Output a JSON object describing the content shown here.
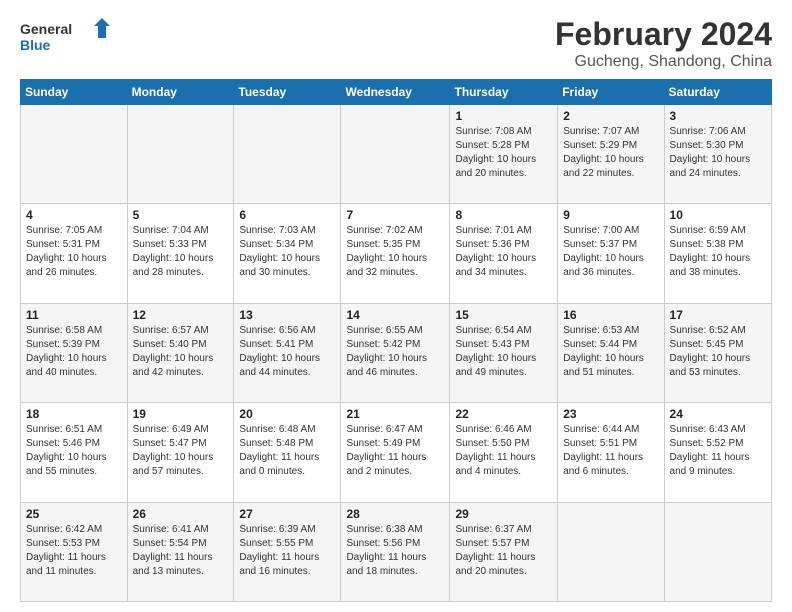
{
  "logo": {
    "text_general": "General",
    "text_blue": "Blue"
  },
  "header": {
    "title": "February 2024",
    "subtitle": "Gucheng, Shandong, China"
  },
  "weekdays": [
    "Sunday",
    "Monday",
    "Tuesday",
    "Wednesday",
    "Thursday",
    "Friday",
    "Saturday"
  ],
  "weeks": [
    [
      {
        "day": "",
        "info": ""
      },
      {
        "day": "",
        "info": ""
      },
      {
        "day": "",
        "info": ""
      },
      {
        "day": "",
        "info": ""
      },
      {
        "day": "1",
        "info": "Sunrise: 7:08 AM\nSunset: 5:28 PM\nDaylight: 10 hours\nand 20 minutes."
      },
      {
        "day": "2",
        "info": "Sunrise: 7:07 AM\nSunset: 5:29 PM\nDaylight: 10 hours\nand 22 minutes."
      },
      {
        "day": "3",
        "info": "Sunrise: 7:06 AM\nSunset: 5:30 PM\nDaylight: 10 hours\nand 24 minutes."
      }
    ],
    [
      {
        "day": "4",
        "info": "Sunrise: 7:05 AM\nSunset: 5:31 PM\nDaylight: 10 hours\nand 26 minutes."
      },
      {
        "day": "5",
        "info": "Sunrise: 7:04 AM\nSunset: 5:33 PM\nDaylight: 10 hours\nand 28 minutes."
      },
      {
        "day": "6",
        "info": "Sunrise: 7:03 AM\nSunset: 5:34 PM\nDaylight: 10 hours\nand 30 minutes."
      },
      {
        "day": "7",
        "info": "Sunrise: 7:02 AM\nSunset: 5:35 PM\nDaylight: 10 hours\nand 32 minutes."
      },
      {
        "day": "8",
        "info": "Sunrise: 7:01 AM\nSunset: 5:36 PM\nDaylight: 10 hours\nand 34 minutes."
      },
      {
        "day": "9",
        "info": "Sunrise: 7:00 AM\nSunset: 5:37 PM\nDaylight: 10 hours\nand 36 minutes."
      },
      {
        "day": "10",
        "info": "Sunrise: 6:59 AM\nSunset: 5:38 PM\nDaylight: 10 hours\nand 38 minutes."
      }
    ],
    [
      {
        "day": "11",
        "info": "Sunrise: 6:58 AM\nSunset: 5:39 PM\nDaylight: 10 hours\nand 40 minutes."
      },
      {
        "day": "12",
        "info": "Sunrise: 6:57 AM\nSunset: 5:40 PM\nDaylight: 10 hours\nand 42 minutes."
      },
      {
        "day": "13",
        "info": "Sunrise: 6:56 AM\nSunset: 5:41 PM\nDaylight: 10 hours\nand 44 minutes."
      },
      {
        "day": "14",
        "info": "Sunrise: 6:55 AM\nSunset: 5:42 PM\nDaylight: 10 hours\nand 46 minutes."
      },
      {
        "day": "15",
        "info": "Sunrise: 6:54 AM\nSunset: 5:43 PM\nDaylight: 10 hours\nand 49 minutes."
      },
      {
        "day": "16",
        "info": "Sunrise: 6:53 AM\nSunset: 5:44 PM\nDaylight: 10 hours\nand 51 minutes."
      },
      {
        "day": "17",
        "info": "Sunrise: 6:52 AM\nSunset: 5:45 PM\nDaylight: 10 hours\nand 53 minutes."
      }
    ],
    [
      {
        "day": "18",
        "info": "Sunrise: 6:51 AM\nSunset: 5:46 PM\nDaylight: 10 hours\nand 55 minutes."
      },
      {
        "day": "19",
        "info": "Sunrise: 6:49 AM\nSunset: 5:47 PM\nDaylight: 10 hours\nand 57 minutes."
      },
      {
        "day": "20",
        "info": "Sunrise: 6:48 AM\nSunset: 5:48 PM\nDaylight: 11 hours\nand 0 minutes."
      },
      {
        "day": "21",
        "info": "Sunrise: 6:47 AM\nSunset: 5:49 PM\nDaylight: 11 hours\nand 2 minutes."
      },
      {
        "day": "22",
        "info": "Sunrise: 6:46 AM\nSunset: 5:50 PM\nDaylight: 11 hours\nand 4 minutes."
      },
      {
        "day": "23",
        "info": "Sunrise: 6:44 AM\nSunset: 5:51 PM\nDaylight: 11 hours\nand 6 minutes."
      },
      {
        "day": "24",
        "info": "Sunrise: 6:43 AM\nSunset: 5:52 PM\nDaylight: 11 hours\nand 9 minutes."
      }
    ],
    [
      {
        "day": "25",
        "info": "Sunrise: 6:42 AM\nSunset: 5:53 PM\nDaylight: 11 hours\nand 11 minutes."
      },
      {
        "day": "26",
        "info": "Sunrise: 6:41 AM\nSunset: 5:54 PM\nDaylight: 11 hours\nand 13 minutes."
      },
      {
        "day": "27",
        "info": "Sunrise: 6:39 AM\nSunset: 5:55 PM\nDaylight: 11 hours\nand 16 minutes."
      },
      {
        "day": "28",
        "info": "Sunrise: 6:38 AM\nSunset: 5:56 PM\nDaylight: 11 hours\nand 18 minutes."
      },
      {
        "day": "29",
        "info": "Sunrise: 6:37 AM\nSunset: 5:57 PM\nDaylight: 11 hours\nand 20 minutes."
      },
      {
        "day": "",
        "info": ""
      },
      {
        "day": "",
        "info": ""
      }
    ]
  ]
}
